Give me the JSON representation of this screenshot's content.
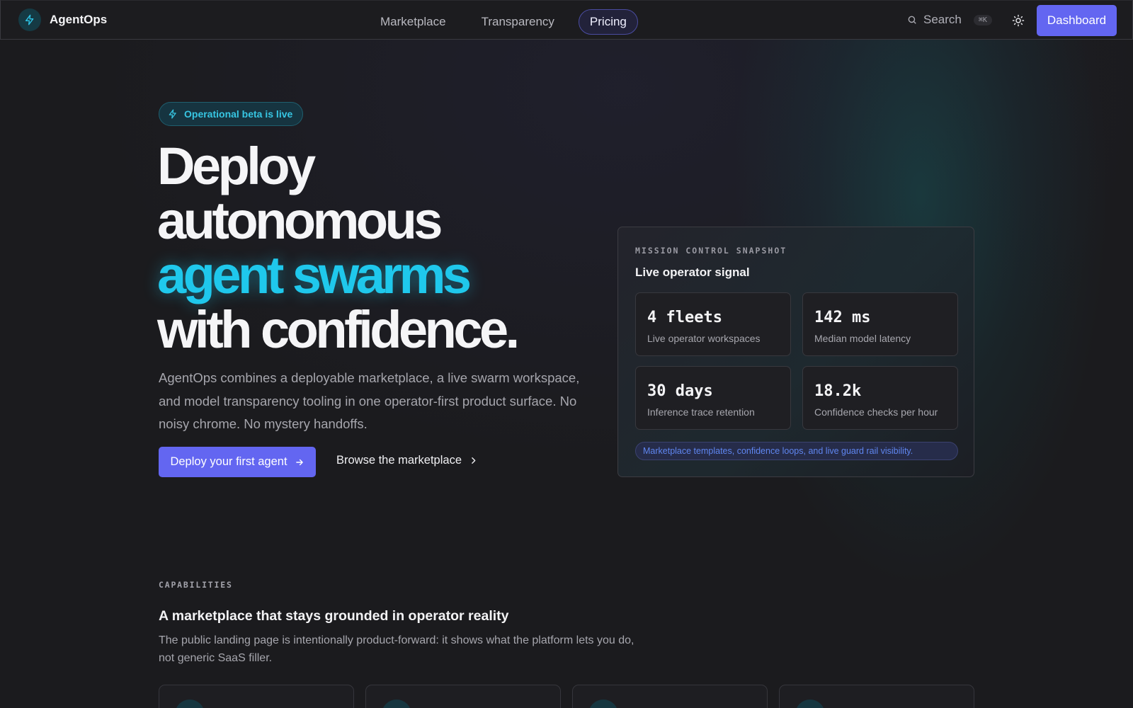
{
  "nav": {
    "brand": "AgentOps",
    "links": [
      {
        "label": "Marketplace",
        "active": false
      },
      {
        "label": "Transparency",
        "active": false
      },
      {
        "label": "Pricing",
        "active": true
      }
    ],
    "search_label": "Search",
    "search_shortcut": "⌘K",
    "dashboard_label": "Dashboard"
  },
  "hero": {
    "badge": "Operational beta is live",
    "headline_line1": "Deploy",
    "headline_line2": "autonomous",
    "headline_accent": "agent swarms",
    "headline_line4": "with confidence.",
    "lede": "AgentOps combines a deployable marketplace, a live swarm workspace, and model transparency tooling in one operator-first product surface. No noisy chrome. No mystery handoffs.",
    "primary_cta": "Deploy your first agent",
    "secondary_cta": "Browse the marketplace"
  },
  "snapshot": {
    "kicker": "MISSION CONTROL SNAPSHOT",
    "title": "Live operator signal",
    "stats": [
      {
        "value": "4 fleets",
        "label": "Live operator workspaces"
      },
      {
        "value": "142 ms",
        "label": "Median model latency"
      },
      {
        "value": "30 days",
        "label": "Inference trace retention"
      },
      {
        "value": "18.2k",
        "label": "Confidence checks per hour"
      }
    ],
    "note": "Marketplace templates, confidence loops, and live guard rail visibility."
  },
  "capabilities": {
    "kicker": "CAPABILITIES",
    "title": "A marketplace that stays grounded in operator reality",
    "description": "The public landing page is intentionally product-forward: it shows what the platform lets you do, not generic SaaS filler."
  },
  "colors": {
    "accent": "#6366f1",
    "cyan": "#1fc8ec",
    "background": "#1b1b1e"
  },
  "icons": [
    "bolt-icon",
    "search-icon",
    "sun-icon",
    "arrow-right-icon",
    "chevron-right-icon"
  ]
}
